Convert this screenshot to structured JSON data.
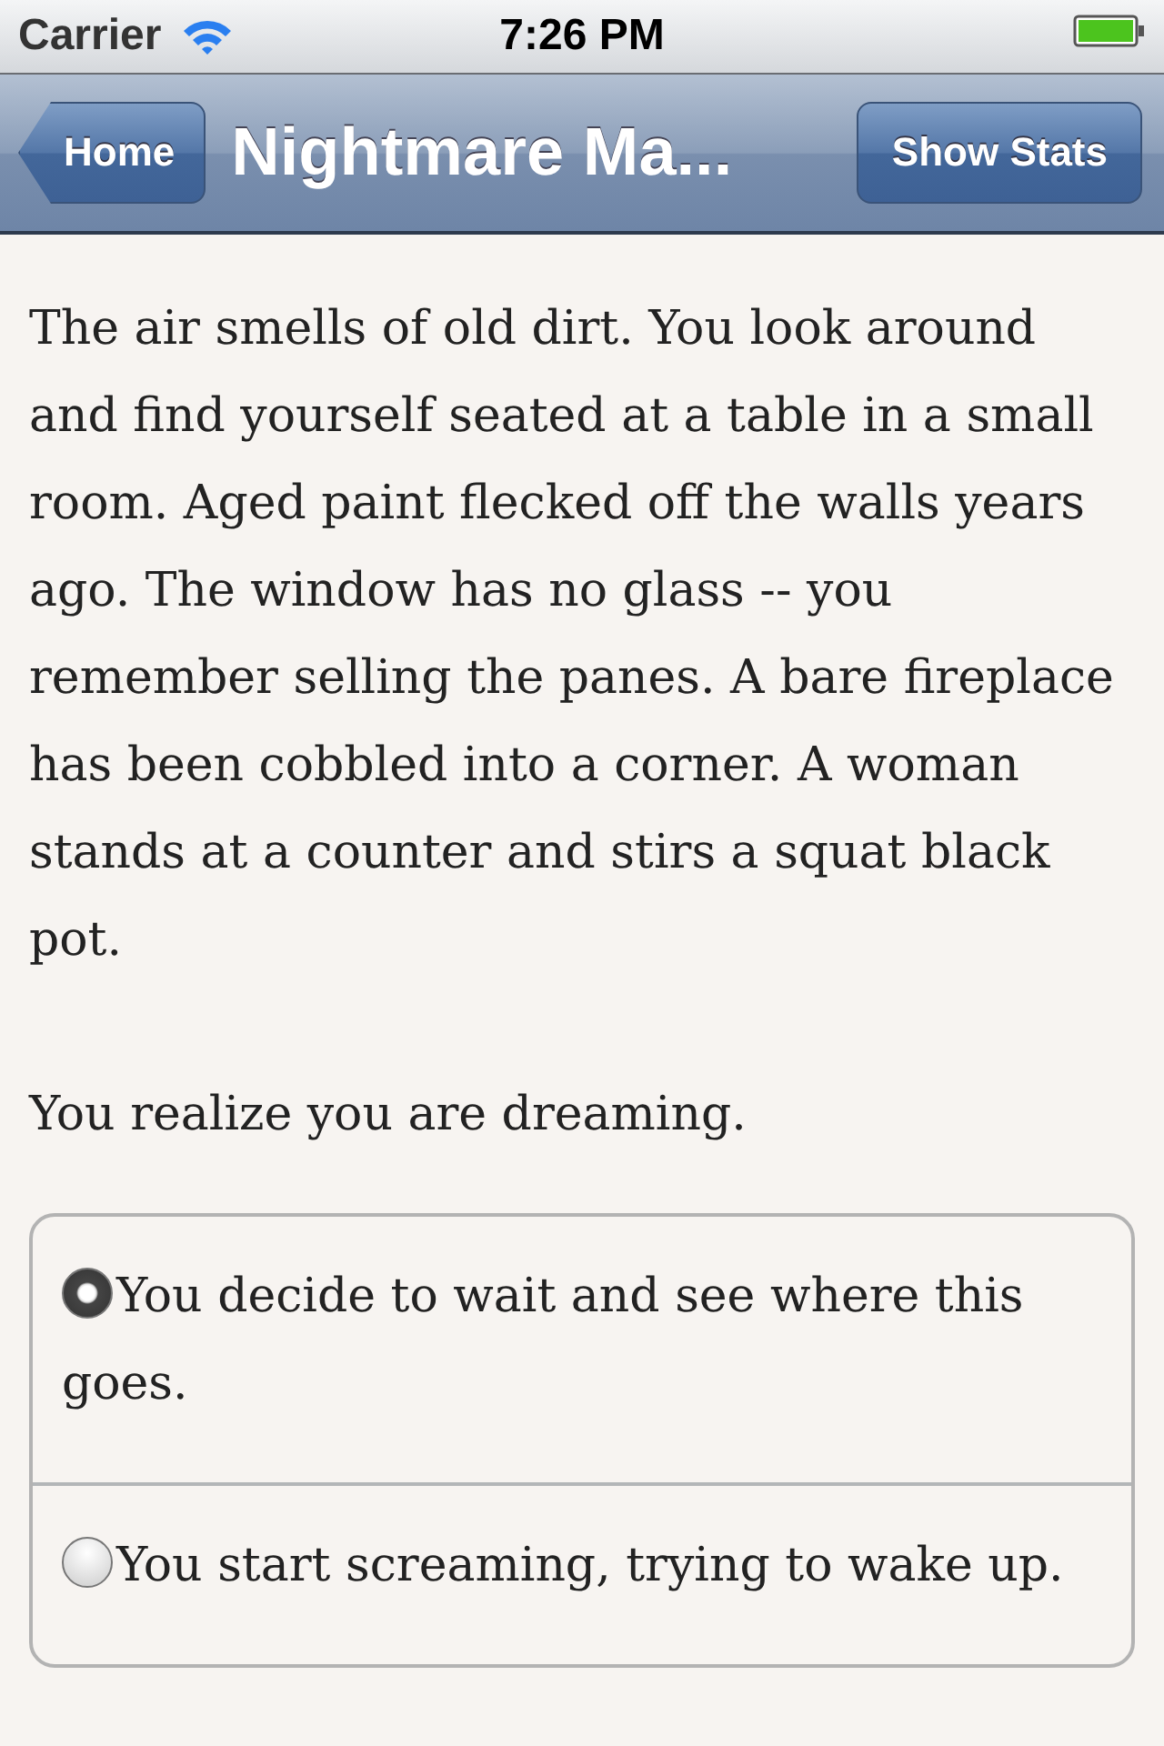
{
  "status_bar": {
    "carrier": "Carrier",
    "time": "7:26 PM"
  },
  "nav_bar": {
    "back_button": "Home",
    "title": "Nightmare Ma...",
    "action_button": "Show Stats"
  },
  "story": [
    "The air smells of old dirt. You look around and find yourself seated at a table in a small room. Aged paint flecked off the walls years ago. The window has no glass -- you remember selling the panes. A bare fireplace has been cobbled into a corner. A woman stands at a counter and stirs a squat black pot.",
    "You realize you are dreaming."
  ],
  "choices": [
    {
      "label": "You decide to wait and see where this goes.",
      "selected": true
    },
    {
      "label": "You start screaming, trying to wake up.",
      "selected": false
    }
  ]
}
